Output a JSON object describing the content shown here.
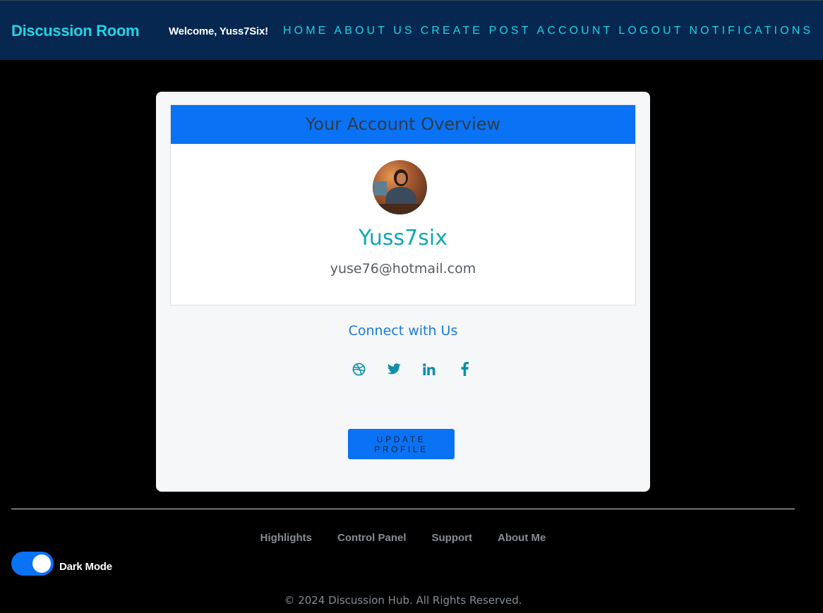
{
  "navbar": {
    "brand": "Discussion Room",
    "welcome": "Welcome, Yuss7Six!",
    "links": [
      "HOME",
      "ABOUT US",
      "CREATE POST",
      "ACCOUNT",
      "LOGOUT",
      "NOTIFICATIONS"
    ]
  },
  "account": {
    "title": "Your Account Overview",
    "username": "Yuss7six",
    "email": "yuse76@hotmail.com"
  },
  "connect": {
    "heading": "Connect with Us",
    "icons": [
      "dribbble-icon",
      "twitter-icon",
      "linkedin-icon",
      "facebook-icon"
    ]
  },
  "actions": {
    "update_label": "UPDATE PROFILE"
  },
  "footer": {
    "links": [
      "Highlights",
      "Control Panel",
      "Support",
      "About Me"
    ],
    "dark_mode_label": "Dark Mode",
    "dark_mode_on": true,
    "copyright": "© 2024 Discussion Hub. All Rights Reserved."
  },
  "colors": {
    "navbar_bg": "#052750",
    "accent": "#1ad3e6",
    "primary": "#0a72f5",
    "username": "#12a6b8"
  }
}
